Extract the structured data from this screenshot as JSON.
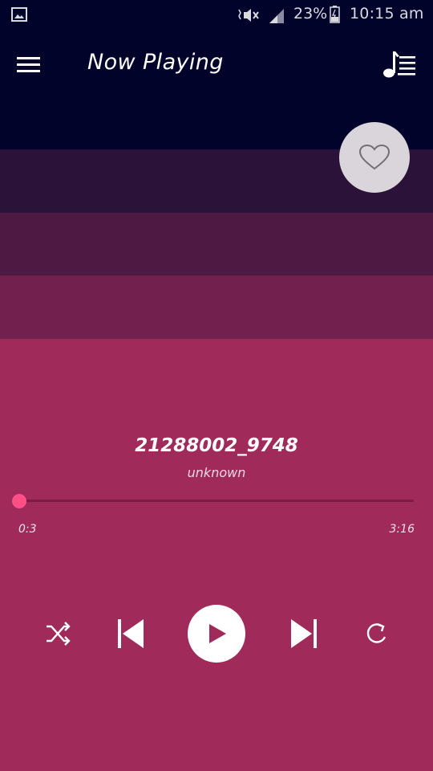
{
  "status_bar": {
    "battery_percent": "23%",
    "time": "10:15 am",
    "icons": [
      "gallery-icon",
      "mute-icon",
      "signal-icon",
      "battery-icon"
    ]
  },
  "app_bar": {
    "title": "Now Playing",
    "menu_icon": "hamburger-menu-icon",
    "queue_icon": "music-queue-icon"
  },
  "track": {
    "title": "21288002_9748",
    "artist": "unknown",
    "favorite_icon": "heart-outline-icon"
  },
  "progress": {
    "elapsed": "0:3",
    "total": "3:16",
    "fraction": 0.015
  },
  "controls": {
    "shuffle_icon": "shuffle-icon",
    "previous_icon": "skip-previous-icon",
    "play_icon": "play-icon",
    "next_icon": "skip-next-icon",
    "repeat_icon": "repeat-icon"
  },
  "colors": {
    "top_bar": "#01032a",
    "band_1": "#2b1239",
    "band_2": "#4e1943",
    "band_3": "#72204d",
    "background": "#a02a5a",
    "accent": "#ff4f86"
  }
}
